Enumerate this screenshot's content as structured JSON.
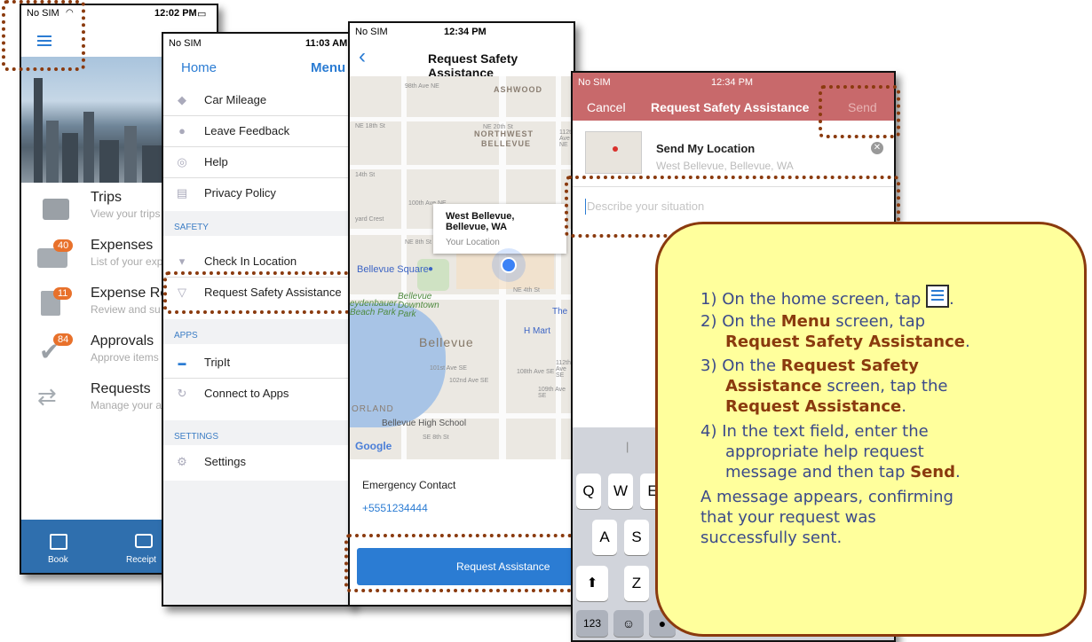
{
  "phone1": {
    "status": {
      "carrier": "No SIM",
      "time": "12:02 PM"
    },
    "items": [
      {
        "title": "Trips",
        "subtitle": "View your trips",
        "badge": ""
      },
      {
        "title": "Expenses",
        "subtitle": "List of your exp",
        "badge": "40"
      },
      {
        "title": "Expense Re",
        "subtitle": "Review and su",
        "badge": "11"
      },
      {
        "title": "Approvals",
        "subtitle": "Approve items",
        "badge": "84"
      },
      {
        "title": "Requests",
        "subtitle": "Manage your a",
        "badge": ""
      }
    ],
    "tabs": [
      "Book",
      "Receipt"
    ]
  },
  "phone2": {
    "status": {
      "carrier": "No SIM",
      "time": "11:03 AM"
    },
    "nav": {
      "left": "Home",
      "right": "Menu"
    },
    "rows_top": [
      "Car Mileage",
      "Leave Feedback",
      "Help",
      "Privacy Policy"
    ],
    "sections": {
      "safety": "SAFETY",
      "apps": "APPS",
      "settings": "SETTINGS"
    },
    "safety_rows": [
      "Check In Location",
      "Request Safety Assistance"
    ],
    "apps_rows": [
      "TripIt",
      "Connect to Apps"
    ],
    "settings_rows": [
      "Settings"
    ]
  },
  "phone3": {
    "status": {
      "carrier": "No SIM",
      "time": "12:34 PM"
    },
    "title": "Request Safety Assistance",
    "map": {
      "areas": [
        "ASHWOOD",
        "NORTHWEST",
        "BELLEVUE",
        "Bellevue"
      ],
      "streets": [
        "NE 20th St",
        "NE 18th St",
        "98th Ave NE",
        "112th Ave NE",
        "14th St",
        "100th Ave NE",
        "yard Crest",
        "NE 8th St",
        "NE 4th St",
        "101st Ave SE",
        "102nd Ave SE",
        "108th Ave SE",
        "109th Ave SE",
        "112th Ave SE",
        "SE 8th St"
      ],
      "places": [
        "Bellevue Square",
        "Bellevue Downtown Park",
        "eydenbauer Beach Park",
        "H Mart",
        "The",
        "ORLAND",
        "Bellevue High School"
      ],
      "popup_title": "West Bellevue, Bellevue, WA",
      "popup_sub": "Your Location",
      "attribution": "Google"
    },
    "emergency_label": "Emergency Contact",
    "emergency_number": "+5551234444",
    "button": "Request Assistance"
  },
  "phone4": {
    "status": {
      "carrier": "No SIM",
      "time": "12:34 PM"
    },
    "cancel": "Cancel",
    "title": "Request Safety Assistance",
    "send": "Send",
    "location_title": "Send My Location",
    "location_sub": "West Bellevue, Bellevue, WA",
    "placeholder": "Describe your situation",
    "keys_row1": [
      "Q",
      "W",
      "E"
    ],
    "keys_row2": [
      "A",
      "S"
    ],
    "keys_row3": [
      "Z"
    ],
    "key_numbers": "123"
  },
  "callout": {
    "s1": "1) On the home screen, tap",
    "s2a": "2) On the ",
    "s2b": "Menu",
    "s2c": " screen, tap",
    "s2d": "Request Safety Assistance",
    "s3a": "3) On the ",
    "s3b": "Request Safety",
    "s3c": "Assistance",
    "s3d": " screen, tap the",
    "s3e": "Request Assistance",
    "s4a": "4) In the text field, enter the",
    "s4b": "appropriate help request",
    "s4c": "message and then tap ",
    "s4d": "Send",
    "conf1": "A message appears, confirming",
    "conf2": "that your request was",
    "conf3": "successfully sent."
  },
  "colors": {
    "accent": "#2b7cd3",
    "header_red": "#c8696b",
    "callout_fill": "#ffff9c",
    "callout_border": "#8a3a0e",
    "badge": "#e8712b"
  }
}
